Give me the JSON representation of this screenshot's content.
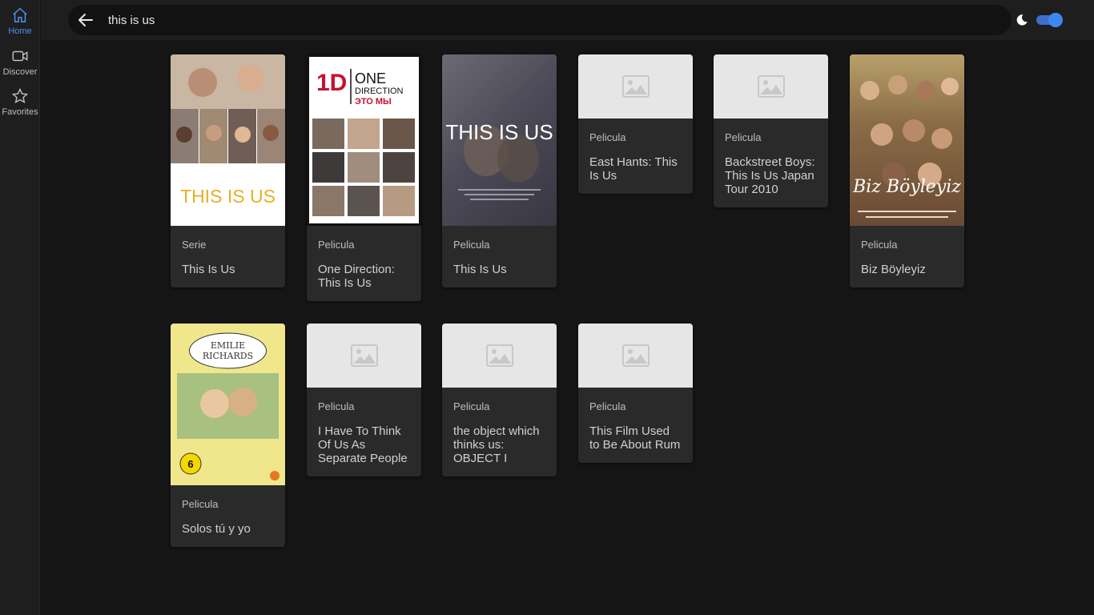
{
  "sidebar": {
    "items": [
      {
        "label": "Home",
        "icon": "home-icon",
        "active": true
      },
      {
        "label": "Discover",
        "icon": "video-camera-icon",
        "active": false
      },
      {
        "label": "Favorites",
        "icon": "star-icon",
        "active": false
      }
    ]
  },
  "search": {
    "value": "this is us"
  },
  "theme": {
    "dark_mode": true,
    "accent": "#3f86f3"
  },
  "results": [
    {
      "kind": "Serie",
      "title": "This Is Us",
      "poster": "This Is Us series poster",
      "poster_text": "THIS IS US"
    },
    {
      "kind": "Pelicula",
      "title": "One Direction: This Is Us",
      "poster": "One Direction poster",
      "poster_text_1": "1D",
      "poster_text_2": "ONE",
      "poster_text_3": "DIRECTION",
      "poster_text_4": "ЭТО МЫ"
    },
    {
      "kind": "Pelicula",
      "title": "This Is Us",
      "poster": "This Is Us film poster",
      "poster_text": "THIS IS US"
    },
    {
      "kind": "Pelicula",
      "title": "East Hants: This Is Us",
      "poster": "placeholder"
    },
    {
      "kind": "Pelicula",
      "title": "Backstreet Boys: This Is Us Japan Tour 2010",
      "poster": "placeholder"
    },
    {
      "kind": "Pelicula",
      "title": "Biz Böyleyiz",
      "poster": "Biz Böyleyiz poster",
      "poster_text": "Biz Böyleyiz"
    },
    {
      "kind": "Pelicula",
      "title": "Solos tú y yo",
      "poster": "Emilie Richards poster",
      "poster_text_1": "EMILIE",
      "poster_text_2": "RICHARDS",
      "rating": "6"
    },
    {
      "kind": "Pelicula",
      "title": "I Have To Think Of Us As Separate People",
      "poster": "placeholder"
    },
    {
      "kind": "Pelicula",
      "title": "the object which thinks us: OBJECT I",
      "poster": "placeholder"
    },
    {
      "kind": "Pelicula",
      "title": "This Film Used to Be About Rum",
      "poster": "placeholder"
    }
  ]
}
